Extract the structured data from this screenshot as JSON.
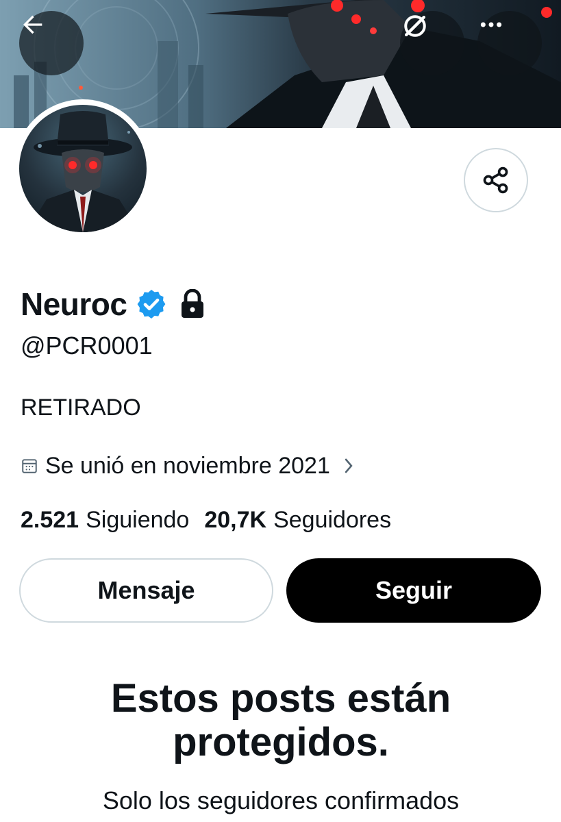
{
  "header": {
    "back_icon": "arrow-left-icon",
    "grok_icon": "grok-icon",
    "more_icon": "more-horizontal-icon"
  },
  "profile": {
    "display_name": "Neuroc",
    "handle": "@PCR0001",
    "bio": "RETIRADO",
    "joined": "Se unió en noviembre 2021",
    "verified": true,
    "protected": true,
    "verified_color": "#1d9bf0"
  },
  "stats": {
    "following_count": "2.521",
    "following_label": "Siguiendo",
    "followers_count": "20,7K",
    "followers_label": "Seguidores"
  },
  "actions": {
    "message_label": "Mensaje",
    "follow_label": "Seguir"
  },
  "protected_notice": {
    "title": "Estos posts están protegidos.",
    "subtitle": "Solo los seguidores confirmados"
  }
}
